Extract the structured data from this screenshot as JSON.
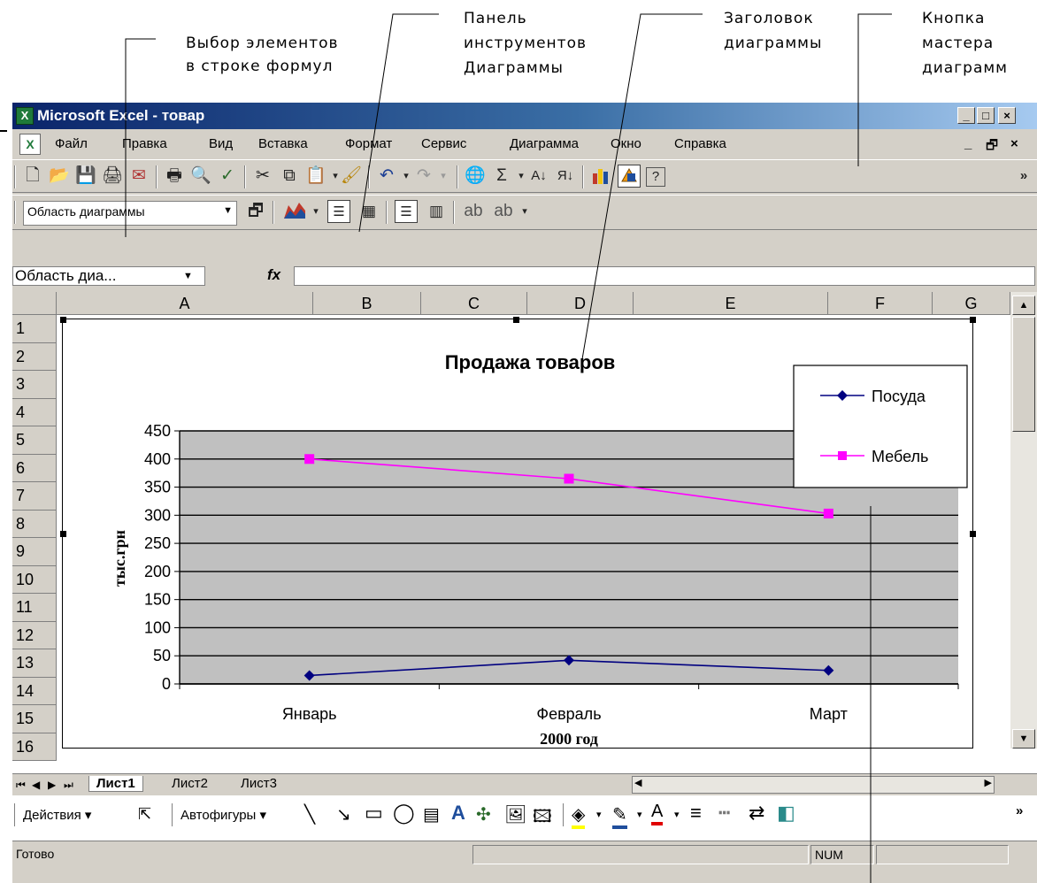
{
  "annotations": {
    "formula_select": [
      "Выбор элементов",
      "в строке формул"
    ],
    "chart_toolbar": [
      "Панель",
      "инструментов",
      "Диаграммы"
    ],
    "chart_title": [
      "Заголовок",
      "диаграммы"
    ],
    "wizard_button": [
      "Кнопка",
      "мастера",
      "диаграмм"
    ]
  },
  "window": {
    "title": "Microsoft Excel - товар",
    "minimize": "_",
    "maximize": "□",
    "close": "×"
  },
  "menu": {
    "items": [
      "Файл",
      "Правка",
      "Вид",
      "Вставка",
      "Формат",
      "Сервис",
      "Диаграмма",
      "Окно",
      "Справка"
    ],
    "doc_controls": [
      "_",
      "🗗",
      "×"
    ]
  },
  "chart_toolbar": {
    "element_select_value": "Область диаграммы",
    "overflow": "»"
  },
  "formula_bar": {
    "name_box_value": "Область диа...",
    "fx_label": "fx",
    "formula_value": ""
  },
  "sheet": {
    "columns": [
      "A",
      "B",
      "C",
      "D",
      "E",
      "F",
      "G"
    ],
    "rows": [
      "1",
      "2",
      "3",
      "4",
      "5",
      "6",
      "7",
      "8",
      "9",
      "10",
      "11",
      "12",
      "13",
      "14",
      "15",
      "16"
    ],
    "tabs": [
      "Лист1",
      "Лист2",
      "Лист3"
    ],
    "active_tab": "Лист1"
  },
  "chart_data": {
    "type": "line",
    "title": "Продажа товаров",
    "xlabel": "2000 год",
    "ylabel": "тыс.грн",
    "categories": [
      "Январь",
      "Февраль",
      "Март"
    ],
    "ylim": [
      0,
      450
    ],
    "yticks": [
      "0",
      "50",
      "100",
      "150",
      "200",
      "250",
      "300",
      "350",
      "400",
      "450"
    ],
    "grid": true,
    "legend": "top-right",
    "series": [
      {
        "name": "Посуда",
        "values": [
          15,
          42,
          24
        ],
        "color": "#000080",
        "marker": "diamond"
      },
      {
        "name": "Мебель",
        "values": [
          400,
          365,
          303
        ],
        "color": "#ff00ff",
        "marker": "square"
      }
    ],
    "plot_background": "#c0c0c0"
  },
  "draw_toolbar": {
    "actions_label": "Действия",
    "autoshapes_label": "Автофигуры"
  },
  "status_bar": {
    "ready": "Готово",
    "num": "NUM"
  }
}
